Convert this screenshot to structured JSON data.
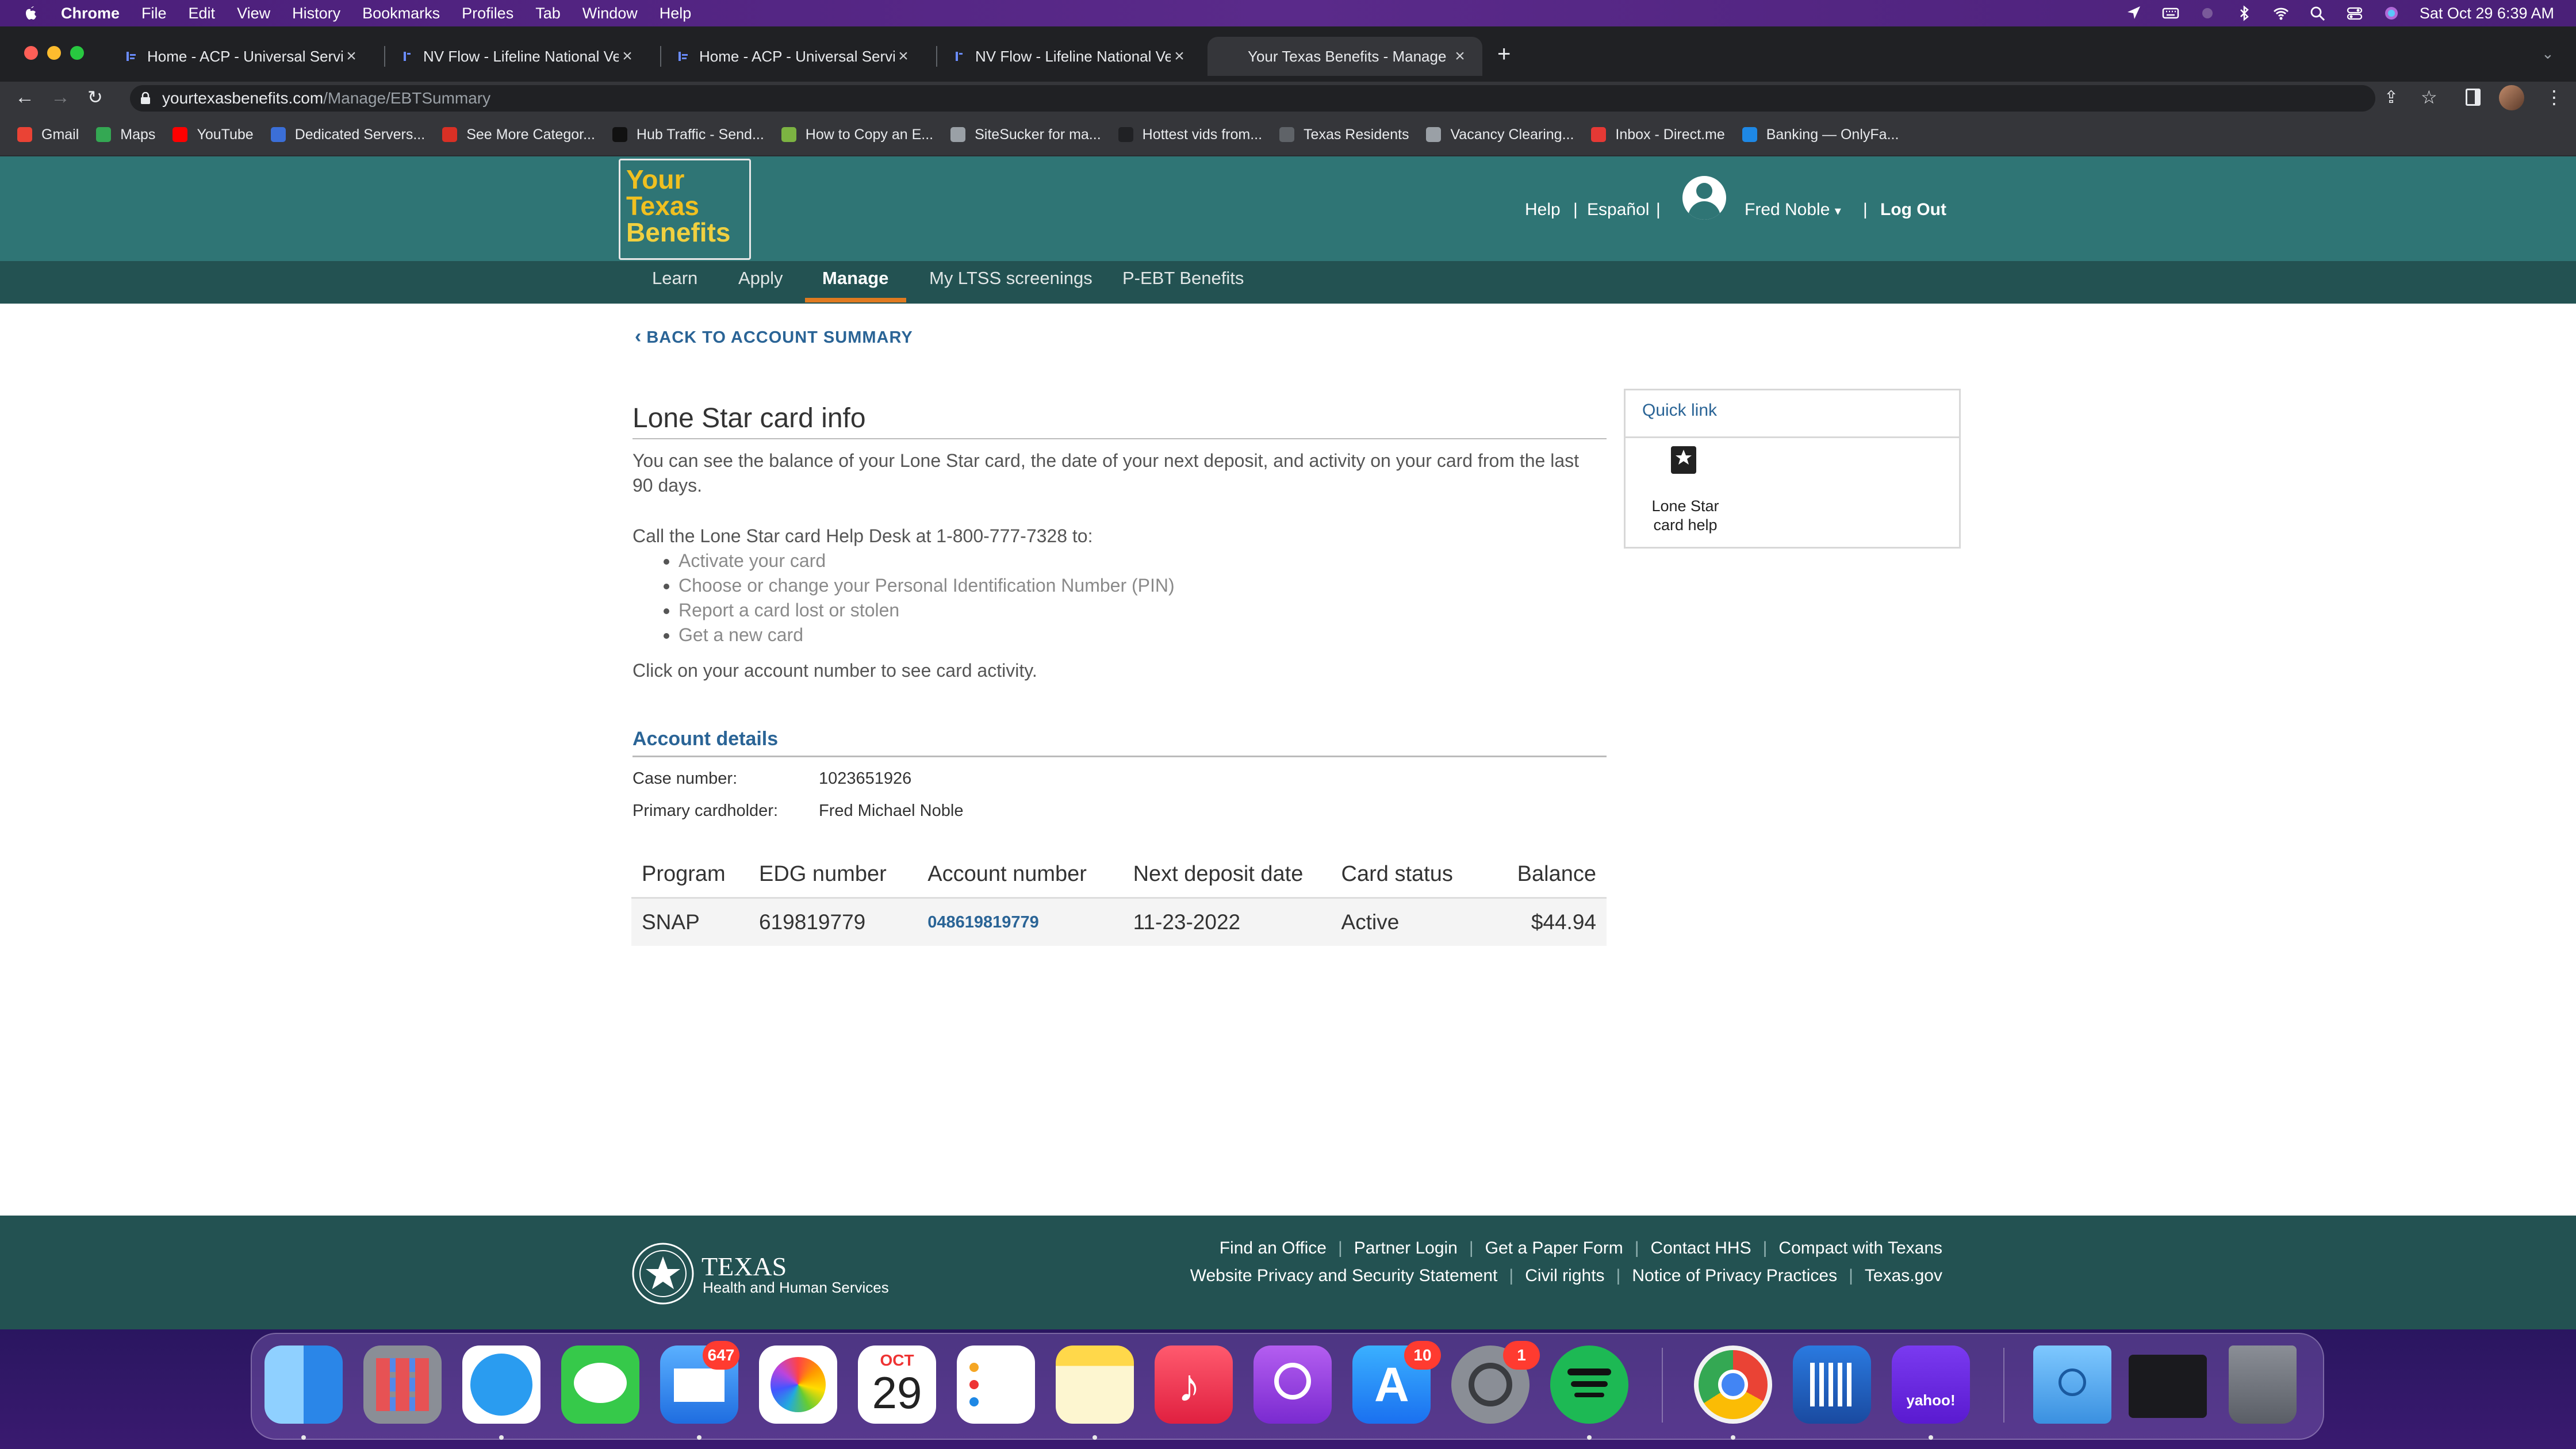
{
  "menubar": {
    "app": "Chrome",
    "items": [
      "File",
      "Edit",
      "View",
      "History",
      "Bookmarks",
      "Profiles",
      "Tab",
      "Window",
      "Help"
    ],
    "clock": "Sat Oct 29  6:39 AM"
  },
  "tabs": [
    {
      "title": "Home - ACP - Universal Servic"
    },
    {
      "title": "NV Flow - Lifeline National Ver"
    },
    {
      "title": "Home - ACP - Universal Servic"
    },
    {
      "title": "NV Flow - Lifeline National Ver"
    },
    {
      "title": "Your Texas Benefits - Manage"
    }
  ],
  "omnibox": {
    "host": "yourtexasbenefits.com",
    "path": "/Manage/EBTSummary"
  },
  "bookmarks": [
    {
      "label": "Gmail",
      "color": "#ea4335"
    },
    {
      "label": "Maps",
      "color": "#34a853"
    },
    {
      "label": "YouTube",
      "color": "#ff0000"
    },
    {
      "label": "Dedicated Servers...",
      "color": "#3b6fd8"
    },
    {
      "label": "See More Categor...",
      "color": "#d93025"
    },
    {
      "label": "Hub Traffic - Send...",
      "color": "#111111"
    },
    {
      "label": "How to Copy an E...",
      "color": "#7cb342"
    },
    {
      "label": "SiteSucker for ma...",
      "color": "#9aa0a6"
    },
    {
      "label": "Hottest vids from...",
      "color": "#202124"
    },
    {
      "label": "Texas Residents",
      "color": "#5f6368"
    },
    {
      "label": "Vacancy Clearing...",
      "color": "#9aa0a6"
    },
    {
      "label": "Inbox - Direct.me",
      "color": "#e53935"
    },
    {
      "label": "Banking — OnlyFa...",
      "color": "#1e88e5"
    }
  ],
  "site": {
    "logo": {
      "line1": "Your",
      "line2": "Texas",
      "line3": "Benefits"
    },
    "header_links": {
      "help": "Help",
      "espanol": "Español",
      "user": "Fred Noble",
      "logout": "Log Out"
    },
    "nav": [
      "Learn",
      "Apply",
      "Manage",
      "My LTSS screenings",
      "P-EBT Benefits"
    ],
    "back": "BACK TO ACCOUNT SUMMARY",
    "title": "Lone Star card info",
    "intro": "You can see the balance of your Lone Star card, the date of your next deposit, and activity on your card from the last 90 days.",
    "call": "Call the Lone Star card Help Desk at 1-800-777-7328 to:",
    "call_items": [
      "Activate your card",
      "Choose or change your Personal Identification Number (PIN)",
      "Report a card lost or stolen",
      "Get a new card"
    ],
    "click_note": "Click on your account number to see card activity.",
    "account_details": {
      "heading": "Account details",
      "case_label": "Case number:",
      "case_value": "1023651926",
      "holder_label": "Primary cardholder:",
      "holder_value": "Fred Michael Noble"
    },
    "table": {
      "headers": [
        "Program",
        "EDG number",
        "Account number",
        "Next deposit date",
        "Card status",
        "Balance"
      ],
      "rows": [
        [
          "SNAP",
          "619819779",
          "048619819779",
          "11-23-2022",
          "Active",
          "$44.94"
        ]
      ]
    },
    "quick_link": {
      "title": "Quick link",
      "label": "Lone Star card help"
    },
    "footer": {
      "org": "TEXAS",
      "org_sub": "Health and Human Services",
      "row1": [
        "Find an Office",
        "Partner Login",
        "Get a Paper Form",
        "Contact HHS",
        "Compact with Texans"
      ],
      "row2": [
        "Website Privacy and Security Statement",
        "Civil rights",
        "Notice of Privacy Practices",
        "Texas.gov"
      ]
    }
  },
  "dock": {
    "badges": {
      "mail": "647",
      "appstore": "10",
      "settings": "1"
    },
    "calendar": {
      "month": "OCT",
      "day": "29"
    }
  }
}
